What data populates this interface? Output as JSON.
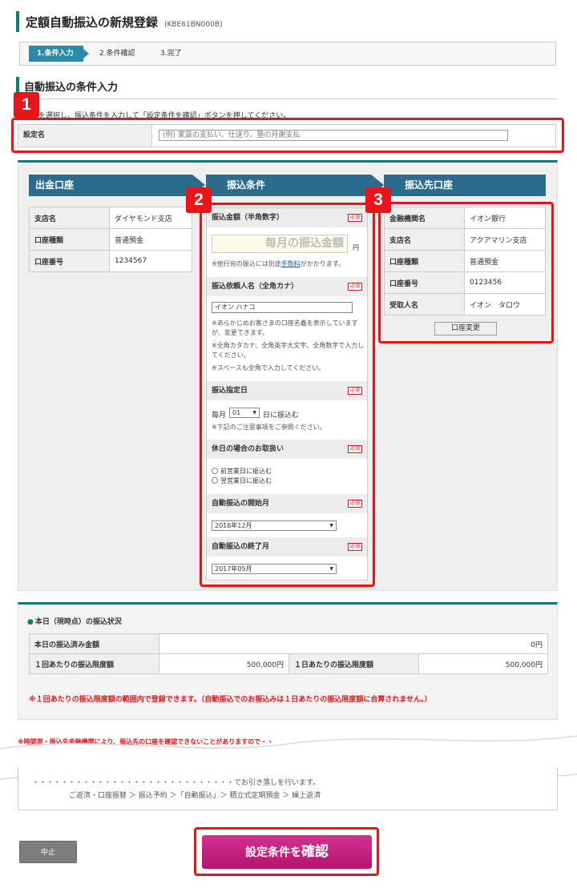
{
  "page": {
    "title": "定額自動振込の新規登録",
    "code": "(KBE61BN000B)"
  },
  "steps": [
    "1.条件入力",
    "2.条件確認",
    "3.完了"
  ],
  "section": {
    "title": "自動振込の条件入力",
    "intro": "口座を選択し、振込条件を入力して「設定条件を確認」ボタンを押してください。"
  },
  "badges": [
    "1",
    "2",
    "3"
  ],
  "setting": {
    "label": "設定名",
    "placeholder": "(例) 家賃の支払い、仕送り、塾の月謝支払"
  },
  "source": {
    "header": "出金口座",
    "rows": [
      {
        "k": "支店名",
        "v": "ダイヤモンド支店"
      },
      {
        "k": "口座種類",
        "v": "普通預金"
      },
      {
        "k": "口座番号",
        "v": "1234567"
      }
    ]
  },
  "conditions": {
    "header": "振込条件",
    "required": "必須",
    "amount": {
      "label": "振込金額（半角数字）",
      "placeholder": "毎月の振込金額",
      "unit": "円",
      "note_before": "※他行宛の振込には別途",
      "fee_link": "手数料",
      "note_after": "がかかります。"
    },
    "requester": {
      "label": "振込依頼人名（全角カナ）",
      "value": "イオン ハナコ",
      "notes": [
        "※あらかじめお客さまの口座名義を表示していますが、変更できます。",
        "※全角カタカナ、全角英字大文字、全角数字で入力してください。",
        "※スペースも全角で入力してください。"
      ]
    },
    "day": {
      "label": "振込指定日",
      "prefix": "毎月",
      "value": "01",
      "suffix": "日に振込む",
      "note": "※下記のご注意事項をご参照ください。"
    },
    "holiday": {
      "label": "休日の場合のお取扱い",
      "options": [
        "前営業日に振込む",
        "翌営業日に振込む"
      ]
    },
    "start": {
      "label": "自動振込の開始月",
      "value": "2016年12月"
    },
    "end": {
      "label": "自動振込の終了月",
      "value": "2017年05月"
    }
  },
  "dest": {
    "header": "振込先口座",
    "rows": [
      {
        "k": "金融機関名",
        "v": "イオン銀行"
      },
      {
        "k": "支店名",
        "v": "アクアマリン支店"
      },
      {
        "k": "口座種類",
        "v": "普通預金"
      },
      {
        "k": "口座番号",
        "v": "0123456"
      },
      {
        "k": "受取人名",
        "v": "イオン　タロウ"
      }
    ],
    "change_button": "口座変更"
  },
  "status": {
    "title": "本日（現時点）の振込状況",
    "done_label": "本日の振込済み金額",
    "done_value": "0円",
    "per_label": "１回あたりの振込限度額",
    "per_value": "500,000円",
    "day_label": "１日あたりの振込限度額",
    "day_value": "500,000円",
    "warning": "※１回あたりの振込限度額の範囲内で登録できます。（自動振込でのお振込みは１日あたりの振込限度額に合算されません。）"
  },
  "notice_top": "※時間帯・振込先金融機関により、振込先の口座を確認できないことがありますので・・",
  "notice_mid": "・・・・・・・・・・・・・・・・・・・・・・・・・・・・でお引き落しを行います。",
  "notice_bottom": "ご返済・口座振替 ＞ 振込予約 ＞「自動振込」＞ 積立式定期預金 ＞ 繰上返済",
  "buttons": {
    "cancel": "中止",
    "confirm_prefix": "設定条件を",
    "confirm_main": "確認"
  }
}
